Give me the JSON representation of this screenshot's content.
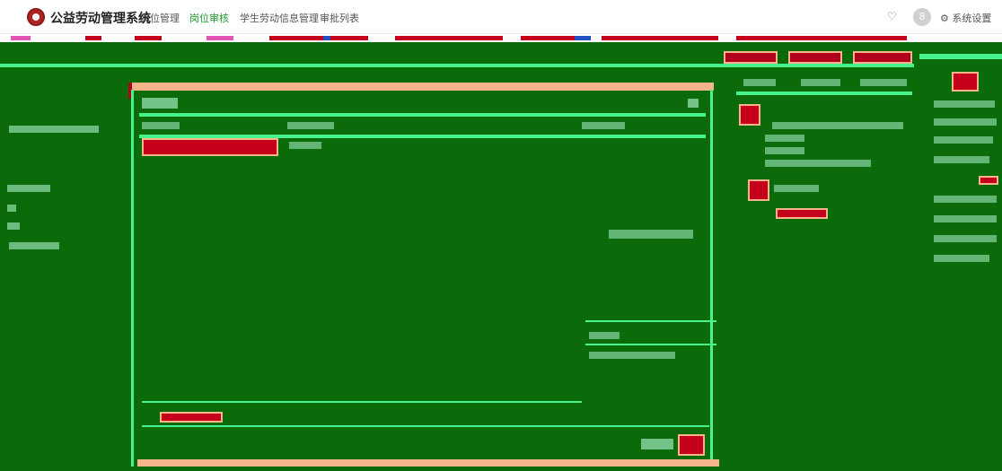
{
  "topnav": {
    "title": "公益劳动管理系统",
    "items": [
      {
        "label": "岗位管理",
        "active": false
      },
      {
        "label": "岗位审核",
        "active": true
      },
      {
        "label": "学生劳动信息管理",
        "active": false
      },
      {
        "label": "审批列表",
        "active": false
      }
    ],
    "bell_icon": "bell-icon",
    "avatar_glyph": "8",
    "settings_label": "系统设置",
    "settings_icon": "gear-icon"
  },
  "colors": {
    "nav_active": "#1f9a2b",
    "background": "#0b6b0b",
    "accent_line": "#49f28c",
    "highlight": "#f7b48a",
    "danger": "#c4001a"
  }
}
